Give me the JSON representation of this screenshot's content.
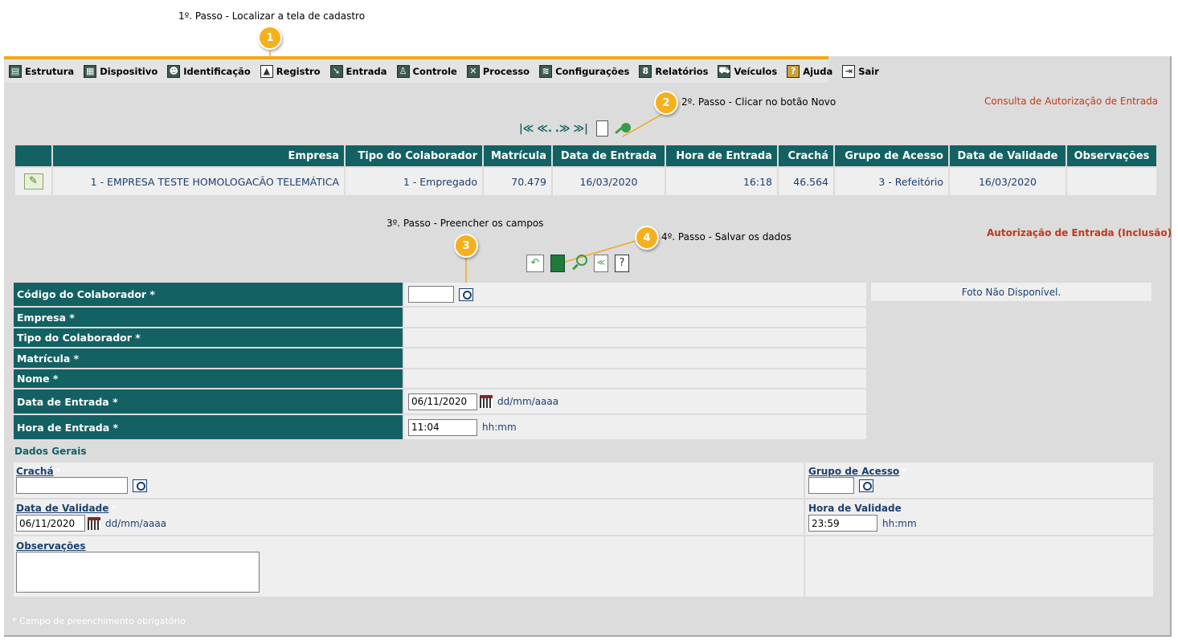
{
  "notes": {
    "step1": "1º. Passo - Localizar a tela de cadastro",
    "step2": "2º. Passo - Clicar no botão Novo",
    "step3": "3º. Passo - Preencher os campos",
    "step4": "4º. Passo - Salvar os dados"
  },
  "callouts": [
    "1",
    "2",
    "3",
    "4"
  ],
  "menu": [
    {
      "label": "Estrutura",
      "icon": "structure-icon"
    },
    {
      "label": "Dispositivo",
      "icon": "device-icon"
    },
    {
      "label": "Identificação",
      "icon": "identification-icon"
    },
    {
      "label": "Registro",
      "icon": "register-icon"
    },
    {
      "label": "Entrada",
      "icon": "entry-icon"
    },
    {
      "label": "Controle",
      "icon": "control-icon"
    },
    {
      "label": "Processo",
      "icon": "process-icon"
    },
    {
      "label": "Configurações",
      "icon": "settings-icon"
    },
    {
      "label": "Relatórios",
      "icon": "reports-icon"
    },
    {
      "label": "Veículos",
      "icon": "vehicles-icon"
    },
    {
      "label": "Ajuda",
      "icon": "help-icon"
    },
    {
      "label": "Sair",
      "icon": "exit-icon"
    }
  ],
  "consulta": {
    "title": "Consulta de Autorização de Entrada",
    "columns": [
      "Empresa",
      "Tipo do Colaborador",
      "Matrícula",
      "Data de Entrada",
      "Hora de Entrada",
      "Crachá",
      "Grupo de Acesso",
      "Data de Validade",
      "Observações"
    ],
    "rows": [
      {
        "empresa": "1 - EMPRESA TESTE HOMOLOGACÃO TELEMÁTICA",
        "tipo": "1 - Empregado",
        "matricula": "70.479",
        "data_entrada": "16/03/2020",
        "hora_entrada": "16:18",
        "cracha": "46.564",
        "grupo": "3 - Refeitório",
        "data_validade": "16/03/2020",
        "observacoes": ""
      }
    ]
  },
  "form": {
    "title": "Autorização de Entrada (Inclusão)",
    "photo": "Foto Não Disponível.",
    "fields": {
      "codigo": "Código do Colaborador *",
      "empresa": "Empresa *",
      "tipo": "Tipo do Colaborador *",
      "matricula": "Matrícula *",
      "nome": "Nome *",
      "data_entrada": "Data de Entrada *",
      "hora_entrada": "Hora de Entrada *"
    },
    "values": {
      "codigo": "",
      "data_entrada": "06/11/2020",
      "hora_entrada": "11:04"
    },
    "hints": {
      "date": "dd/mm/aaaa",
      "time": "hh:mm"
    },
    "section": "Dados Gerais",
    "general": {
      "cracha_label": "Crachá",
      "cracha_value": "",
      "grupo_label": "Grupo de Acesso",
      "grupo_value": "",
      "data_validade_label": "Data de Validade",
      "data_validade_value": "06/11/2020",
      "hora_validade_label": "Hora de Validade",
      "hora_validade_value": "23:59",
      "observacoes_label": "Observações",
      "observacoes_value": "",
      "star": "*"
    },
    "footnote": "* Campo de preenchimento obrigatório"
  },
  "colors": {
    "header": "#136163",
    "accent": "#f0a81e",
    "title": "#c0391b",
    "text": "#1b3f70"
  }
}
